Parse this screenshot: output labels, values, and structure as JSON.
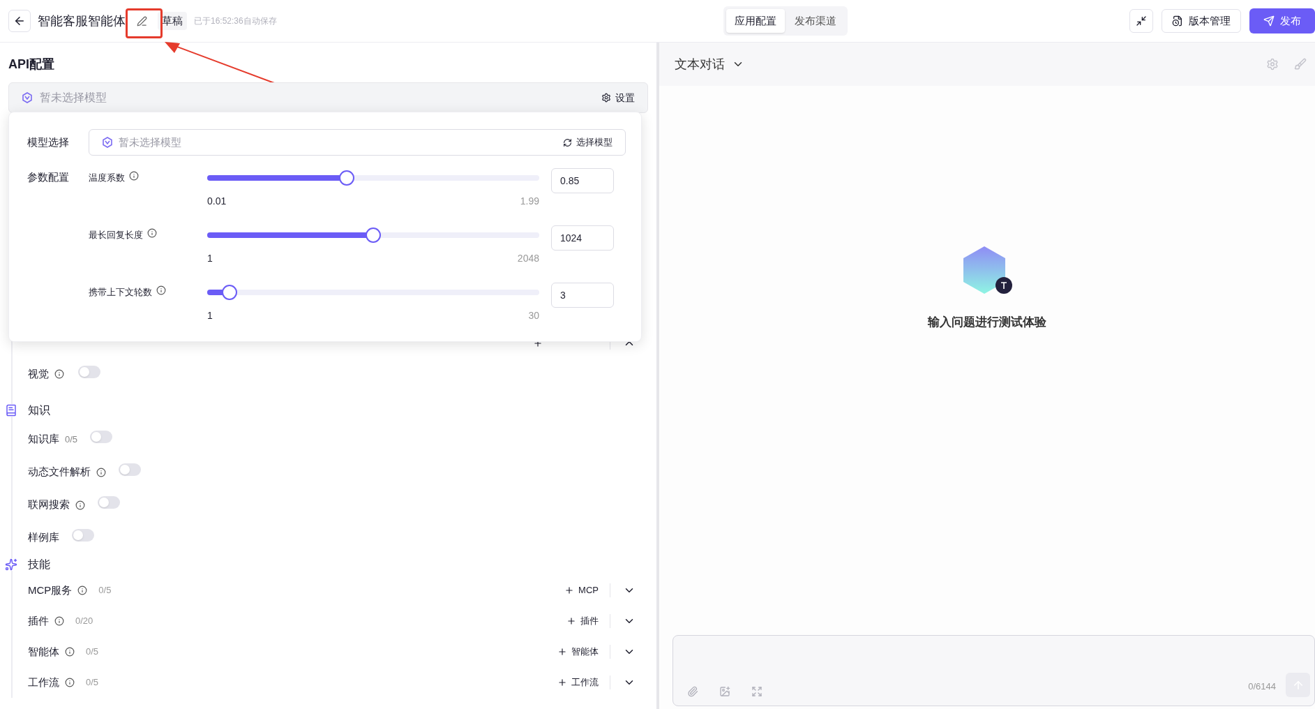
{
  "header": {
    "title": "智能客服智能体",
    "status": "草稿",
    "autosave": "已于16:52:36自动保存",
    "tabs": [
      {
        "label": "应用配置",
        "selected": true
      },
      {
        "label": "发布渠道",
        "selected": false
      }
    ],
    "version_button": "版本管理",
    "publish_button": "发布"
  },
  "left": {
    "title": "API配置",
    "model_bar": {
      "placeholder": "暂未选择模型",
      "settings": "设置"
    },
    "popover": {
      "model_label": "模型选择",
      "model_field": {
        "placeholder": "暂未选择模型",
        "button": "选择模型"
      },
      "params_label": "参数配置",
      "params": [
        {
          "label": "温度系数",
          "level": 0.42,
          "min": "0.01",
          "max": "1.99",
          "value": "0.85"
        },
        {
          "label": "最长回复长度",
          "level": 0.5,
          "min": "1",
          "max": "2048",
          "value": "1024"
        },
        {
          "label": "携带上下文轮数",
          "level": 0.068,
          "min": "1",
          "max": "30",
          "value": "3"
        }
      ]
    },
    "variables": {
      "expanded": true
    },
    "vision": {
      "label": "视觉",
      "info": true,
      "on": false
    },
    "knowledge": {
      "title": "知识",
      "items": [
        {
          "label": "知识库",
          "count": "0/5",
          "info": false,
          "on": false
        },
        {
          "label": "动态文件解析",
          "info": true,
          "on": false
        },
        {
          "label": "联网搜索",
          "info": true,
          "on": false
        },
        {
          "label": "样例库",
          "info": false,
          "on": false
        }
      ]
    },
    "skills": {
      "title": "技能",
      "items": [
        {
          "label": "MCP服务",
          "count": "0/5",
          "add": "MCP",
          "expanded": false
        },
        {
          "label": "插件",
          "count": "0/20",
          "add": "插件",
          "expanded": false
        },
        {
          "label": "智能体",
          "count": "0/5",
          "add": "智能体",
          "expanded": false
        },
        {
          "label": "工作流",
          "count": "0/5",
          "add": "工作流",
          "expanded": false
        }
      ]
    }
  },
  "right": {
    "mode": "文本对话",
    "empty_text": "输入问题进行测试体验",
    "counter": "0/6144"
  }
}
